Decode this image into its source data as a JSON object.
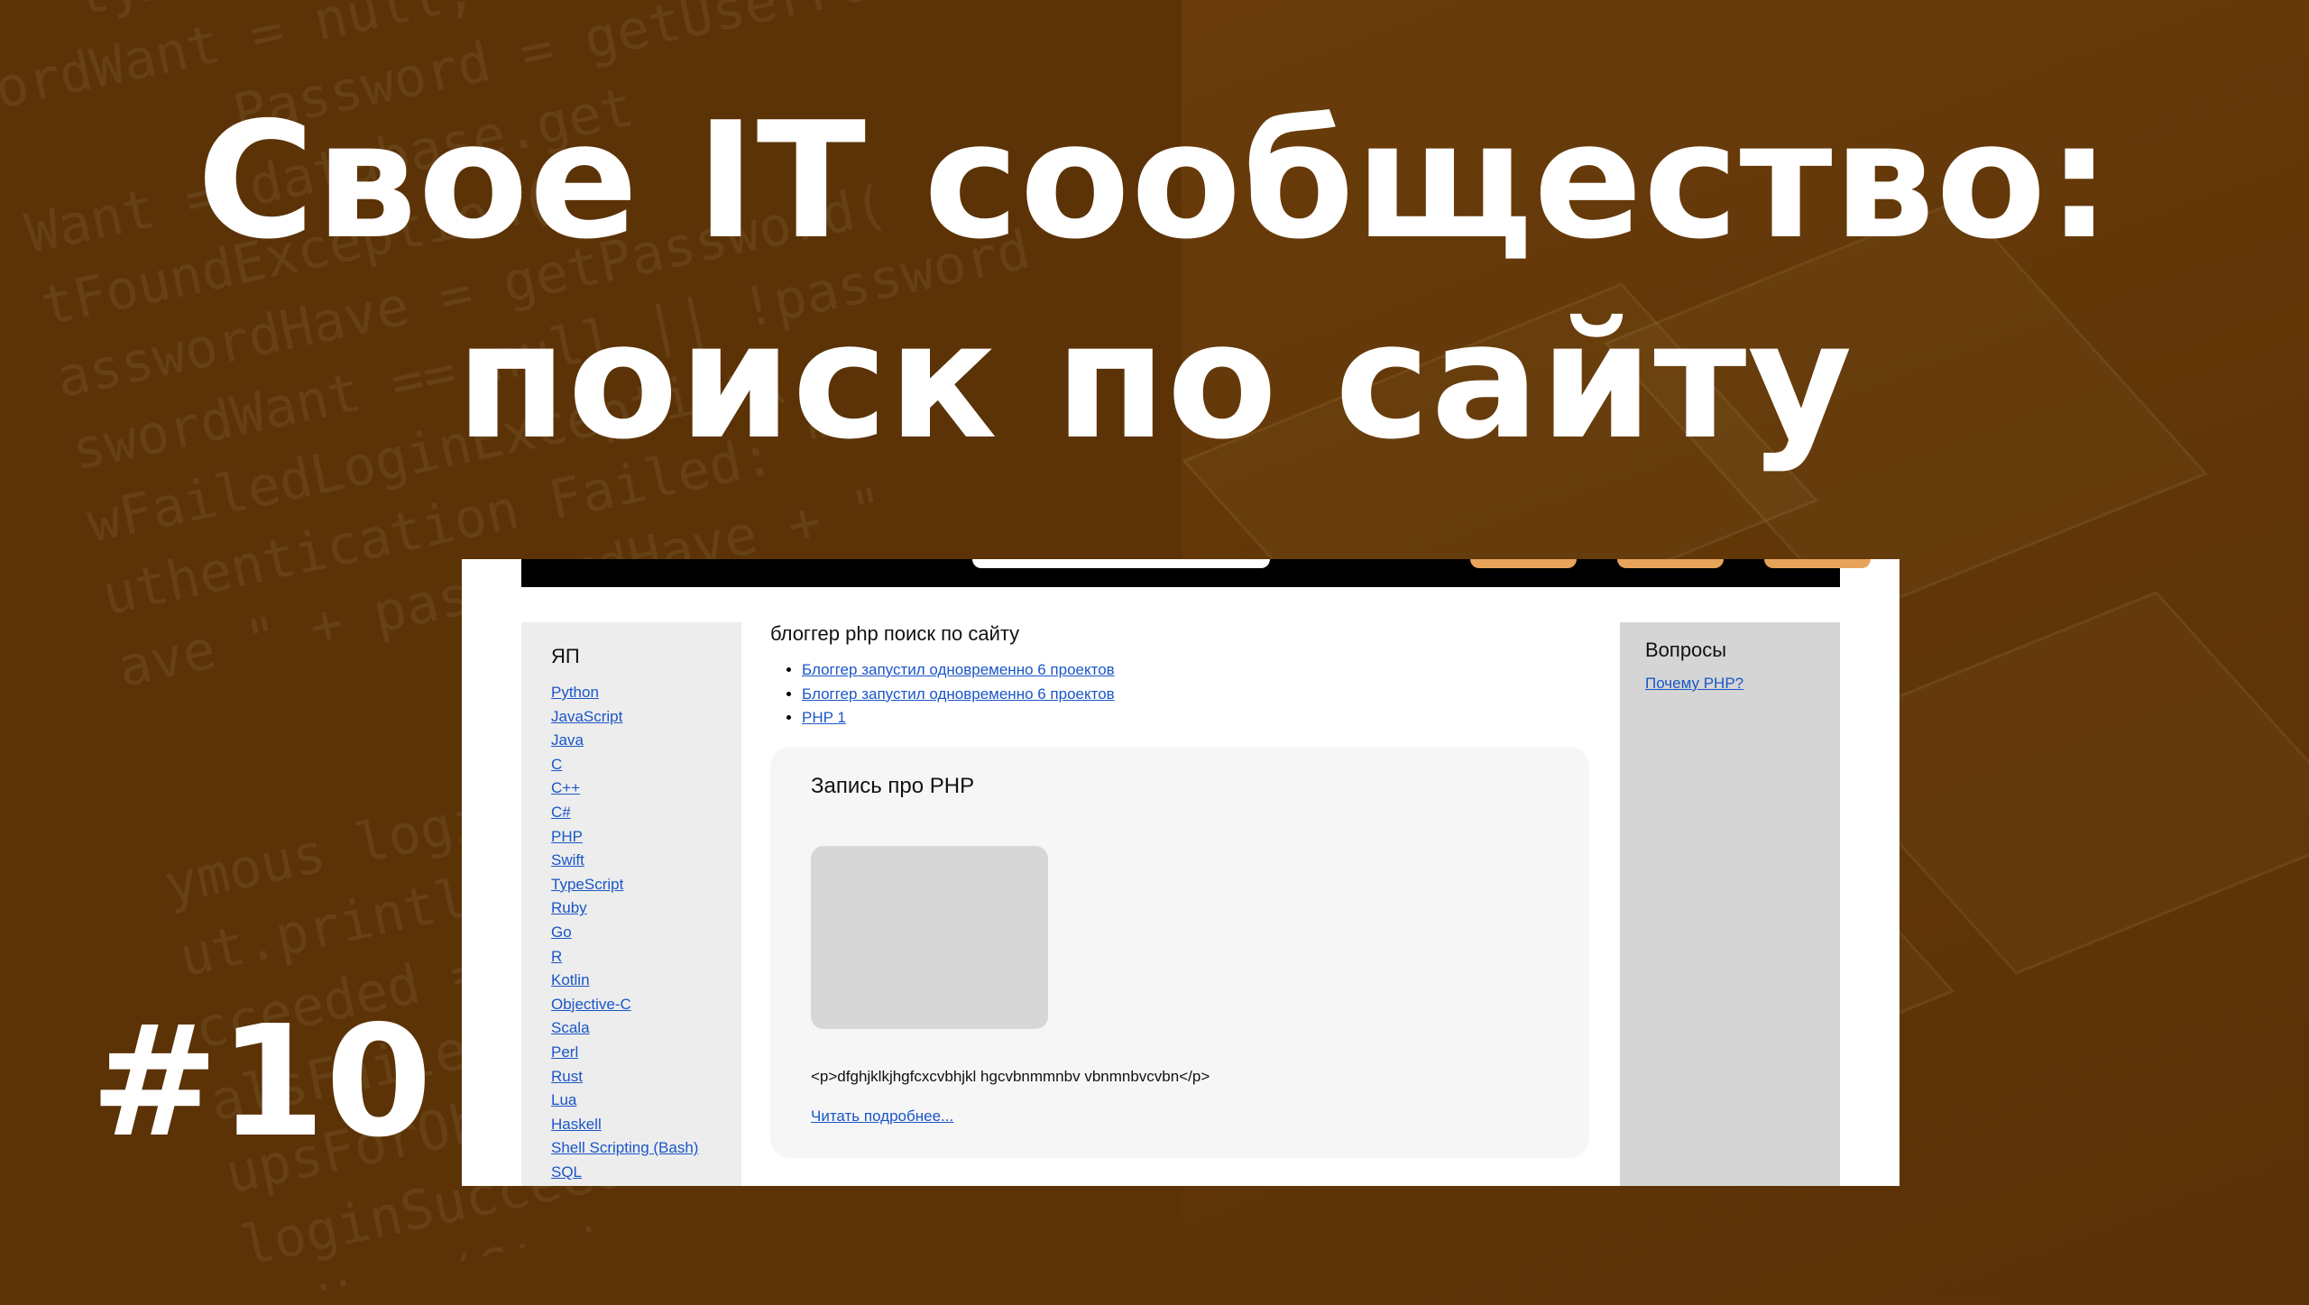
{
  "thumbnail": {
    "title_line1": "Свое IT сообщество:",
    "title_line2": "поиск по сайту",
    "episode": "#10"
  },
  "site": {
    "sidebar": {
      "heading": "ЯП",
      "languages": [
        "Python",
        "JavaScript",
        "Java",
        "C",
        "C++",
        "C#",
        "PHP",
        "Swift",
        "TypeScript",
        "Ruby",
        "Go",
        "R",
        "Kotlin",
        "Objective-C",
        "Scala",
        "Perl",
        "Rust",
        "Lua",
        "Haskell",
        "Shell Scripting (Bash)",
        "SQL"
      ]
    },
    "main": {
      "search_heading": "блоггер php поиск по сайту",
      "results": [
        "Блоггер запустил одновременно 6 проектов",
        "Блоггер запустил одновременно 6 проектов",
        "PHP 1"
      ],
      "card": {
        "title": "Запись про PHP",
        "excerpt": "<p>dfghjklkjhgfcxcvbhjkl hgcvbnmmnbv vbnmnbvcvbn</p>",
        "read_more": "Читать подробнее..."
      }
    },
    "rightbar": {
      "heading": "Вопросы",
      "question_link": "Почему PHP?"
    }
  },
  "colors": {
    "background": "#5b3307",
    "accent_orange": "#e8a35a",
    "link": "#1a56c7"
  }
}
